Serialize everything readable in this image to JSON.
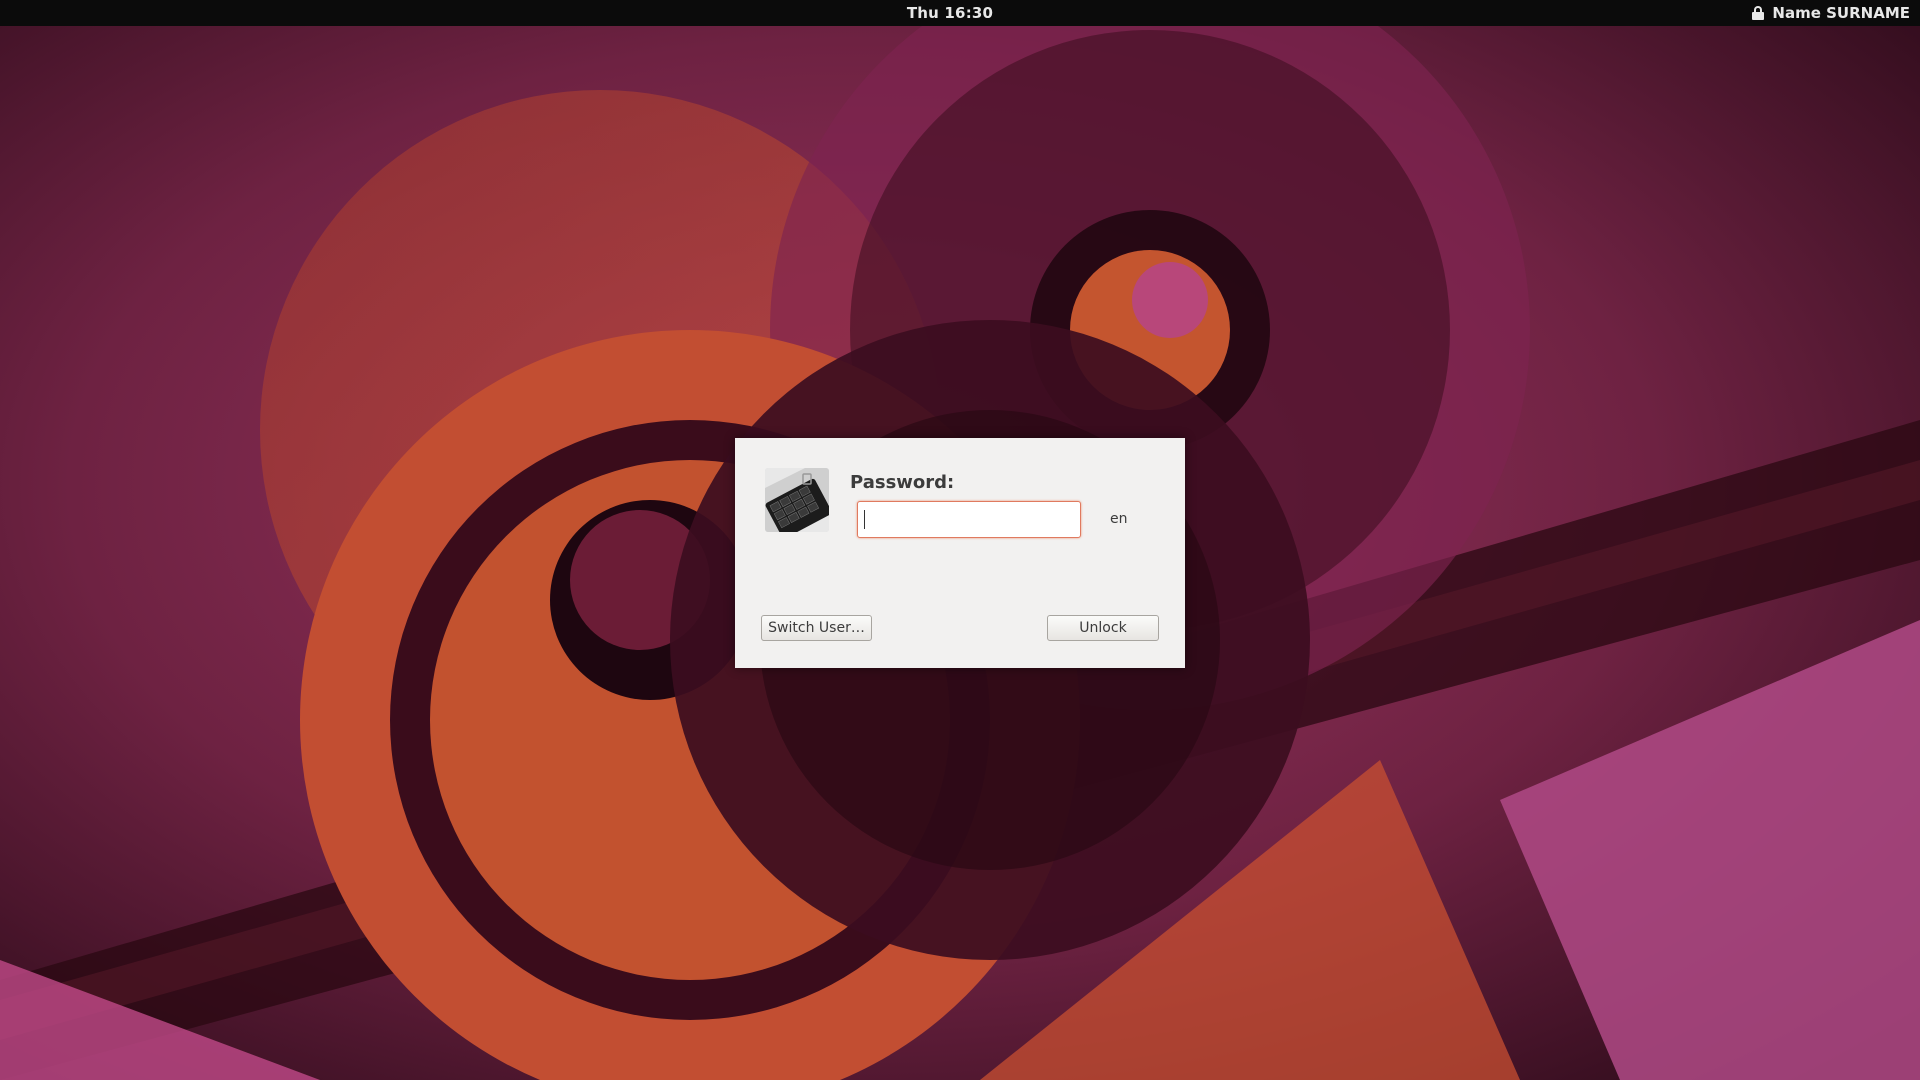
{
  "topbar": {
    "clock": "Thu 16:30",
    "user_name": "Name SURNAME",
    "lock_icon": "lock-icon"
  },
  "dialog": {
    "password_label": "Password:",
    "password_value": "",
    "keyboard_layout": "en",
    "switch_user_label": "Switch User…",
    "unlock_label": "Unlock",
    "avatar_icon": "keyboard-avatar"
  },
  "colors": {
    "topbar_bg": "#0b0b0b",
    "dialog_bg": "#f2f1f0",
    "input_focus_border": "#e07a5f",
    "wallpaper_orange": "#c8502e",
    "wallpaper_magenta": "#8a2a5e"
  }
}
